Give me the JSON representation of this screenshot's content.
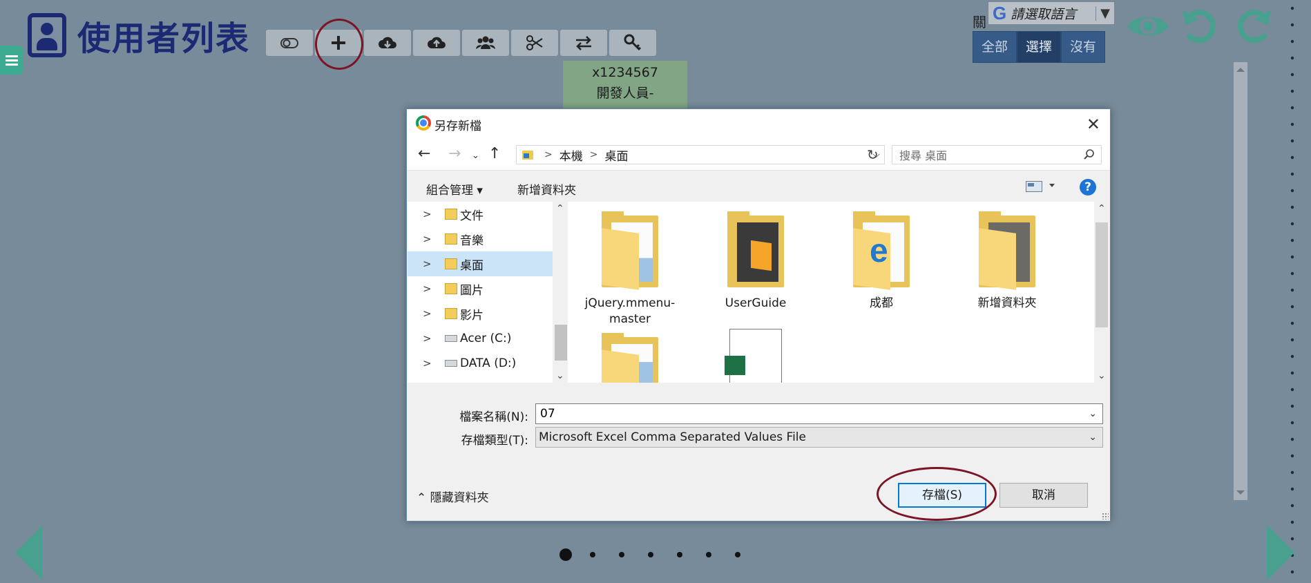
{
  "app": {
    "title": "使用者列表",
    "green_tag": {
      "line1": "x1234567",
      "line2": "開發人員-"
    },
    "lang_label": "關",
    "lang_g": "G",
    "lang_placeholder": "請選取語言",
    "scope_tabs": [
      {
        "label": "全部",
        "selected": false
      },
      {
        "label": "選擇",
        "selected": true
      },
      {
        "label": "沒有",
        "selected": false
      }
    ],
    "toolbar": [
      "toggle-icon",
      "plus-icon",
      "cloud-download-icon",
      "cloud-upload-icon",
      "users-icon",
      "scissors-icon",
      "swap-icon",
      "key-icon"
    ],
    "header_icons": [
      "eye-icon",
      "undo-icon",
      "redo-icon"
    ],
    "pager": {
      "pages": 7,
      "current": 1
    },
    "colors": {
      "accent_green": "#3dab92",
      "title_navy": "#1c2a74",
      "annotation": "#7b1525"
    }
  },
  "dialog": {
    "title": "另存新檔",
    "breadcrumb": [
      "本機",
      "桌面"
    ],
    "search_placeholder": "搜尋 桌面",
    "organize": "組合管理 ▾",
    "new_folder": "新增資料夾",
    "help": "?",
    "tree": [
      {
        "label": "文件",
        "icon": "documents-icon"
      },
      {
        "label": "音樂",
        "icon": "music-icon"
      },
      {
        "label": "桌面",
        "icon": "desktop-icon",
        "selected": true
      },
      {
        "label": "圖片",
        "icon": "pictures-icon"
      },
      {
        "label": "影片",
        "icon": "videos-icon"
      },
      {
        "label": "Acer (C:)",
        "icon": "drive-icon"
      },
      {
        "label": "DATA (D:)",
        "icon": "drive-icon"
      }
    ],
    "items": [
      {
        "label": "jQuery.mmenu-master"
      },
      {
        "label": "UserGuide"
      },
      {
        "label": "成都"
      },
      {
        "label": "新增資料夾"
      }
    ],
    "filename_label": "檔案名稱(N):",
    "filename_value": "07",
    "filetype_label": "存檔類型(T):",
    "filetype_value": "Microsoft Excel Comma Separated Values File",
    "hide_folders": "隱藏資料夾",
    "save": "存檔(S)",
    "cancel": "取消"
  }
}
